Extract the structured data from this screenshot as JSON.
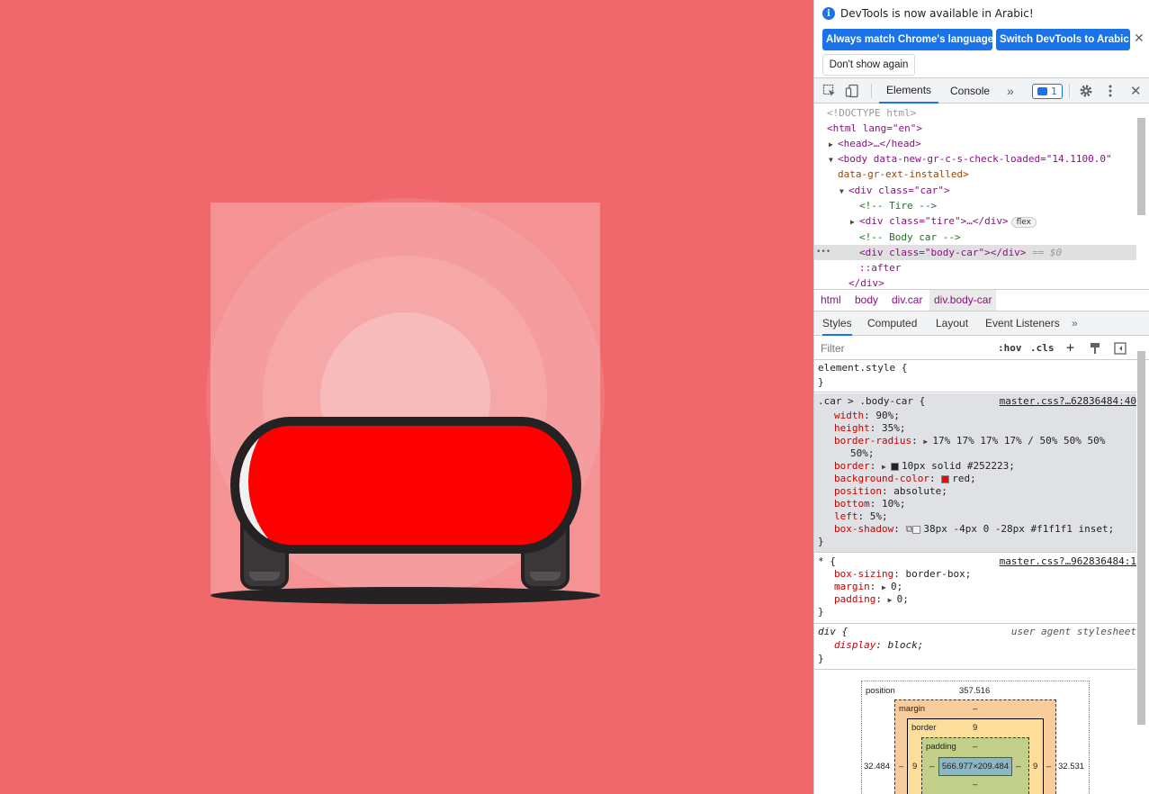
{
  "colors": {
    "page_bg": "#f0686b",
    "car_body": "#ff0000",
    "car_border": "#252223",
    "accent": "#1a73e8"
  },
  "infobar": {
    "message": "DevTools is now available in Arabic!",
    "match_button": "Always match Chrome's language",
    "switch_button": "Switch DevTools to Arabic",
    "dont_show_button": "Don't show again",
    "close_glyph": "✕"
  },
  "toolbar": {
    "tabs": [
      "Elements",
      "Console"
    ],
    "more_glyph": "»",
    "issues_count": "1"
  },
  "dom": {
    "lines": {
      "doctype": "<!DOCTYPE html>",
      "html_open": "<html lang=\"en\">",
      "head": "<head>…</head>",
      "body_open_a": "<body data-new-gr-c-s-check-loaded=\"14.1100.0\"",
      "body_open_b": "data-gr-ext-installed>",
      "div_car": "<div class=\"car\">",
      "comment_tire": "<!-- Tire -->",
      "div_tire": "<div class=\"tire\">…</div>",
      "flex_badge": "flex",
      "comment_body": "<!-- Body car -->",
      "div_body_car": "<div class=\"body-car\"></div>",
      "selected_marker": "== $0",
      "ellipsis": "•••",
      "after": "::after",
      "div_close": "</div>"
    }
  },
  "breadcrumbs": [
    "html",
    "body",
    "div.car",
    "div.body-car"
  ],
  "subtabs": [
    "Styles",
    "Computed",
    "Layout",
    "Event Listeners"
  ],
  "filter": {
    "placeholder": "Filter",
    "hov": ":hov",
    "cls": ".cls",
    "plus": "+"
  },
  "styles": {
    "element_style": {
      "selector": "element.style {",
      "close": "}"
    },
    "body_car": {
      "selector": ".car > .body-car {",
      "source": "master.css?…62836484:40",
      "props": [
        {
          "name": "width",
          "value": "90%;"
        },
        {
          "name": "height",
          "value": "35%;"
        },
        {
          "name": "border-radius",
          "value": "17% 17% 17% 17% / 50% 50% 50%"
        },
        {
          "name": "",
          "value": "50%;"
        },
        {
          "name": "border",
          "value": "10px solid #252223;"
        },
        {
          "name": "background-color",
          "value": "red;"
        },
        {
          "name": "position",
          "value": "absolute;"
        },
        {
          "name": "bottom",
          "value": "10%;"
        },
        {
          "name": "left",
          "value": "5%;"
        },
        {
          "name": "box-shadow",
          "value": "38px -4px 0 -28px #f1f1f1 inset;"
        }
      ],
      "close": "}"
    },
    "universal": {
      "selector": "* {",
      "source": "master.css?…962836484:1",
      "props": [
        {
          "name": "box-sizing",
          "value": "border-box;"
        },
        {
          "name": "margin",
          "value": "0;"
        },
        {
          "name": "padding",
          "value": "0;"
        }
      ],
      "close": "}"
    },
    "div_rule": {
      "selector": "div {",
      "source": "user agent stylesheet",
      "props": [
        {
          "name": "display",
          "value": "block;"
        }
      ],
      "close": "}"
    }
  },
  "box_model": {
    "position_label": "position",
    "position_top": "357.516",
    "position_left": "32.484",
    "position_right": "32.531",
    "margin_label": "margin",
    "margin_top": "–",
    "border_label": "border",
    "border_top": "9",
    "border_left": "9",
    "border_right": "9",
    "padding_label": "padding",
    "padding_top": "–",
    "padding_left": "–",
    "padding_right": "–",
    "padding_bottom": "–",
    "content": "566.977×209.484"
  }
}
